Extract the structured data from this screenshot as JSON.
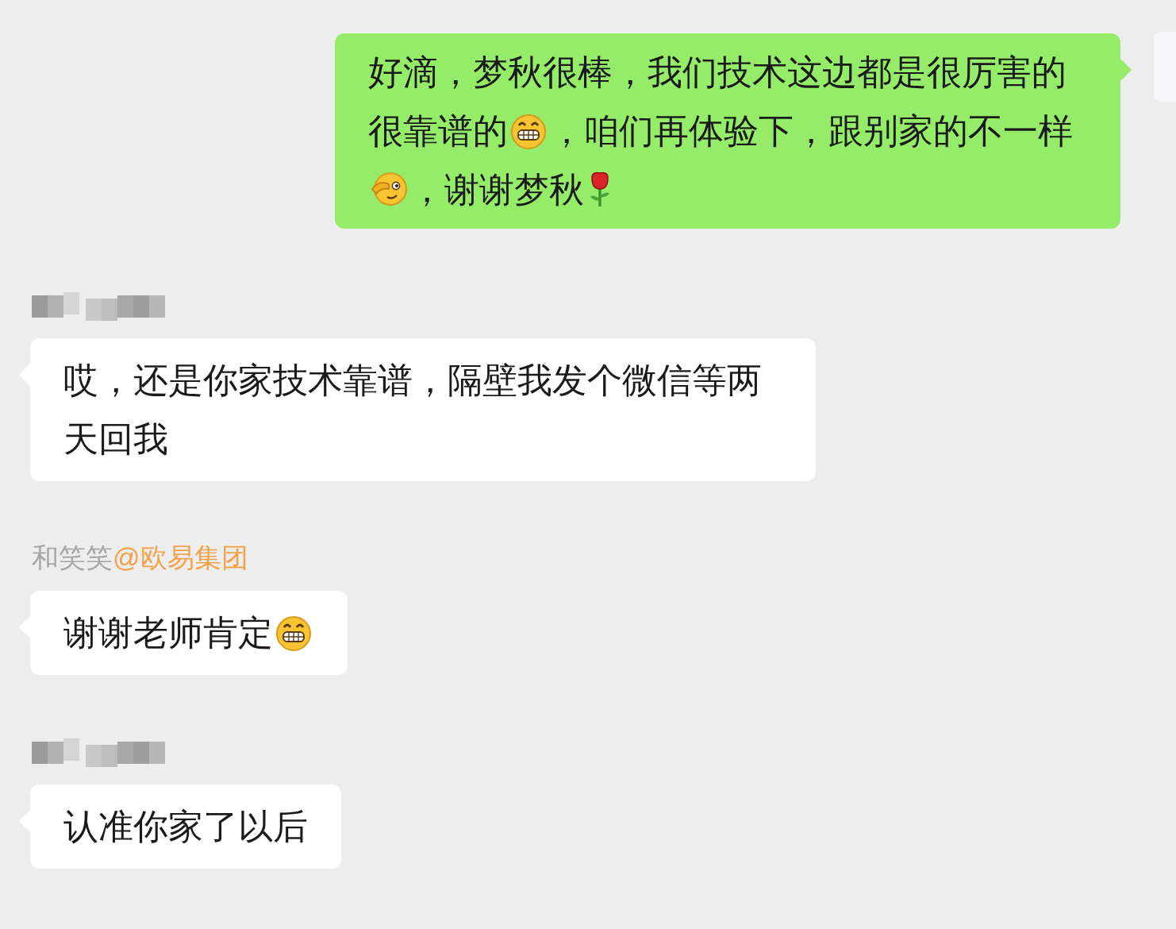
{
  "messages": [
    {
      "kind": "outgoing",
      "segments": [
        {
          "kind": "text",
          "text": "好滴，梦秋很棒，我们技术这边都是很厉害的很靠谱的"
        },
        {
          "kind": "grin"
        },
        {
          "kind": "text",
          "text": "，咱们再体验下，跟别家的不一样"
        },
        {
          "kind": "wink"
        },
        {
          "kind": "text",
          "text": "，谢谢梦秋"
        },
        {
          "kind": "rose"
        }
      ]
    },
    {
      "kind": "incoming",
      "sender": {
        "kind": "blurred"
      },
      "segments": [
        {
          "kind": "text",
          "text": "哎，还是你家技术靠谱，隔壁我发个微信等两天回我"
        }
      ]
    },
    {
      "kind": "incoming",
      "sender": {
        "kind": "named",
        "name": "和笑笑",
        "mention": "@欧易集团"
      },
      "segments": [
        {
          "kind": "text",
          "text": "谢谢老师肯定"
        },
        {
          "kind": "grin"
        }
      ]
    },
    {
      "kind": "incoming",
      "sender": {
        "kind": "blurred"
      },
      "segments": [
        {
          "kind": "text",
          "text": "认准你家了以后"
        }
      ]
    }
  ]
}
